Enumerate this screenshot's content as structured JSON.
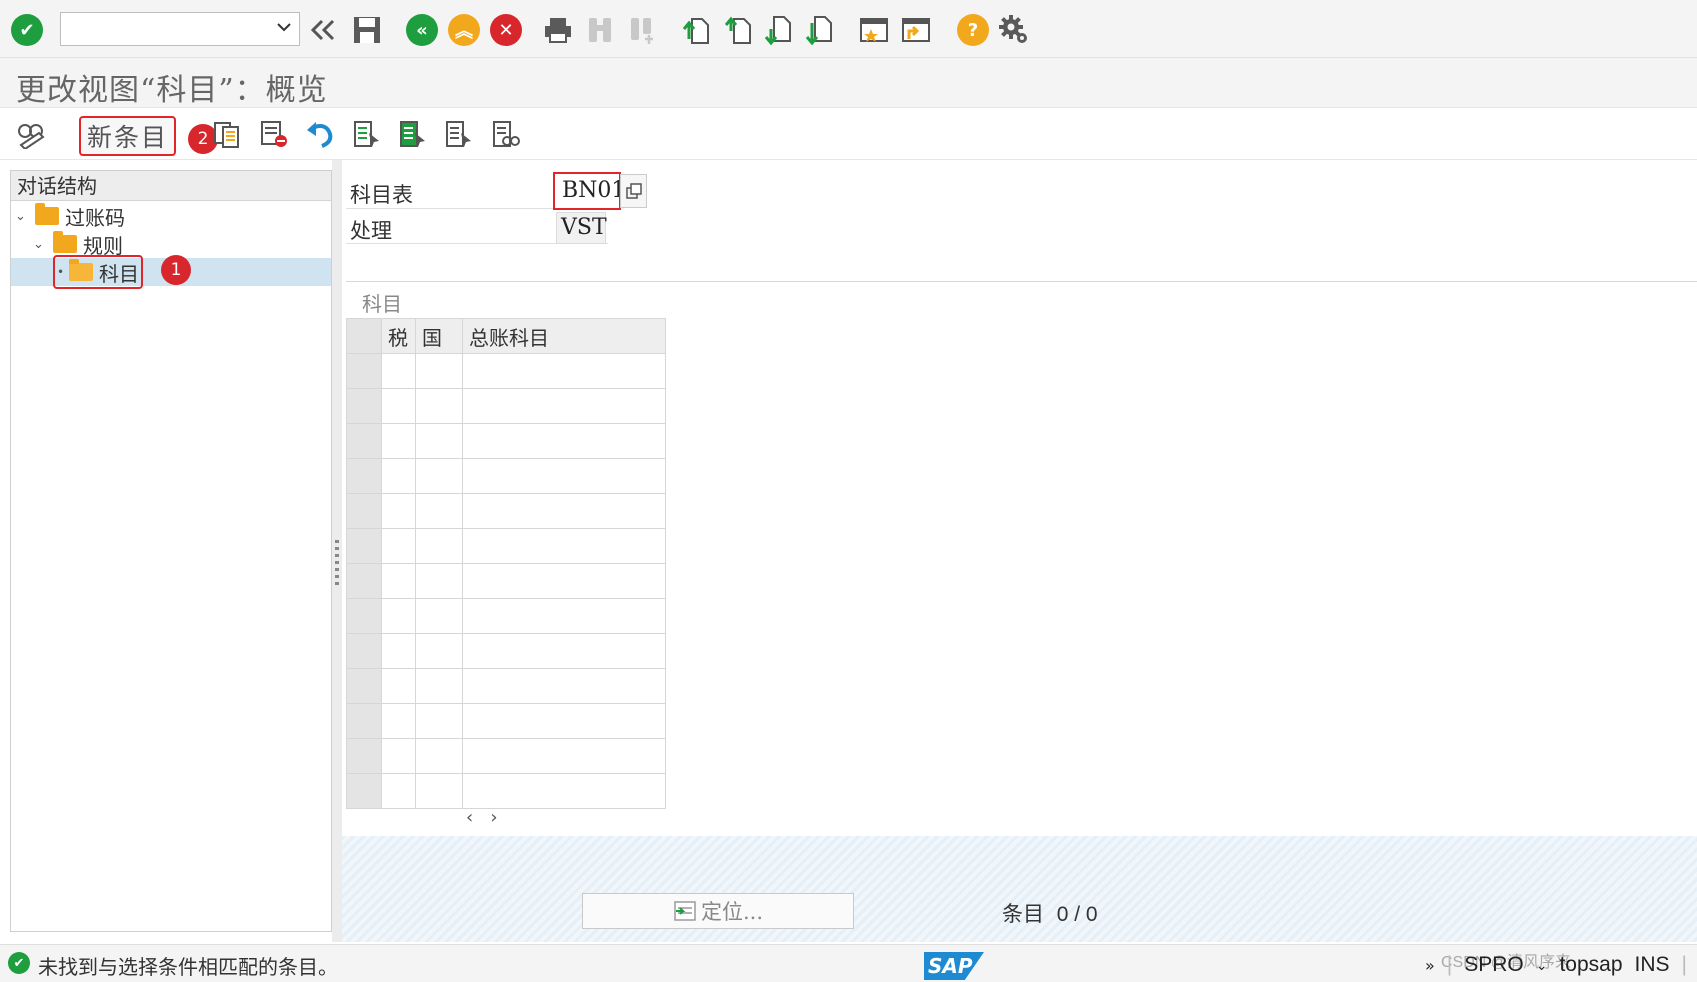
{
  "toolbar": {
    "command_field": {
      "value": "",
      "placeholder": ""
    }
  },
  "title": "更改视图“科目”：概览",
  "app_toolbar": {
    "new_entries_label": "新条目",
    "step2_badge": "2"
  },
  "tree": {
    "header": "对话结构",
    "items": [
      {
        "label": "过账码"
      },
      {
        "label": "规则"
      },
      {
        "label": "科目"
      }
    ],
    "step1_badge": "1"
  },
  "header_fields": {
    "chart_label": "科目表",
    "chart_value": "BN01",
    "process_label": "处理",
    "process_value": "VST"
  },
  "section": {
    "title": "科目",
    "columns": [
      "税",
      "国",
      "总账科目"
    ]
  },
  "footer": {
    "locate_label": "定位...",
    "entries_label": "条目",
    "entries_value": "0 / 0"
  },
  "status": {
    "message": "未找到与选择条件相匹配的条目。",
    "logo": "SAP",
    "transaction": "SPRO",
    "system": "topsap",
    "mode": "INS",
    "watermark": "CSDN @清风序来"
  },
  "colors": {
    "green": "#1e9e3e",
    "orange": "#f2a81d",
    "red": "#d7272c",
    "highlight": "#e0262b",
    "selection": "#cfe3f0"
  }
}
